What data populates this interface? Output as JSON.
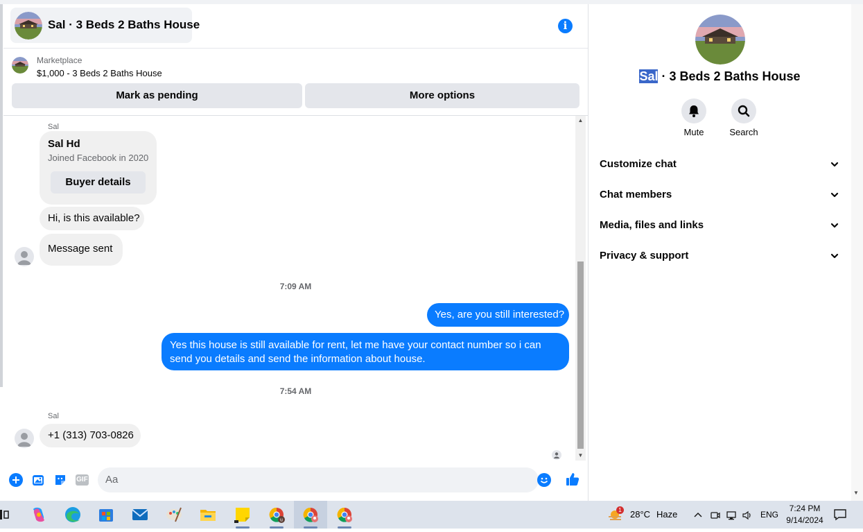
{
  "header": {
    "title": "Sal · 3 Beds 2 Baths House"
  },
  "marketplace": {
    "label": "Marketplace",
    "item": "$1,000 - 3 Beds 2 Baths House",
    "pending_label": "Mark as pending",
    "options_label": "More options"
  },
  "messages": {
    "sender1": "Sal",
    "card_name": "Sal Hd",
    "card_joined": "Joined Facebook in 2020",
    "card_button": "Buyer details",
    "msg1": "Hi, is this available?",
    "msg2": "Message sent",
    "time1": "7:09 AM",
    "out1": "Yes, are you still interested?",
    "out2": "Yes this house is still available for rent, let me have your contact number so i can send you details and send the information about house.",
    "time2": "7:54 AM",
    "sender2": "Sal",
    "phone": "+1 (313) 703-0826"
  },
  "composer": {
    "placeholder": "Aa",
    "gif_label": "GIF"
  },
  "panel": {
    "name_highlight": "Sal",
    "name_rest": " · 3 Beds 2 Baths House",
    "mute_label": "Mute",
    "search_label": "Search",
    "menu": [
      "Customize chat",
      "Chat members",
      "Media, files and links",
      "Privacy & support"
    ]
  },
  "taskbar": {
    "temperature": "28°C",
    "weather": "Haze",
    "weather_badge": "1",
    "language": "ENG",
    "time": "7:24 PM",
    "date": "9/14/2024"
  },
  "colors": {
    "accent": "#0a7cff",
    "bubble_in": "#f0f0f0",
    "taskbar": "#dde3ec"
  }
}
